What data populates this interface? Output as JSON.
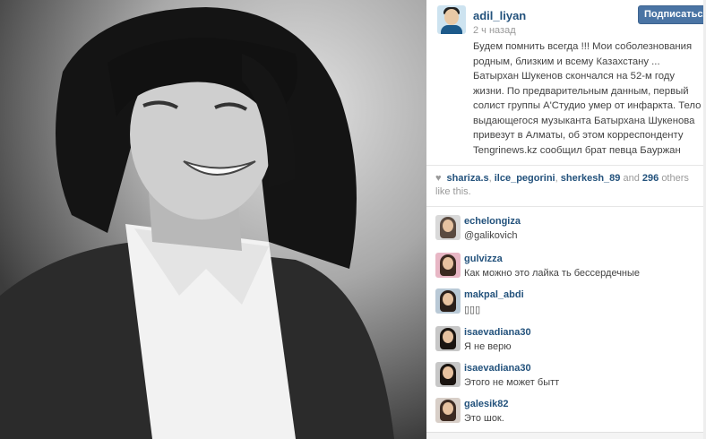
{
  "post": {
    "username": "adil_liyan",
    "time": "2 ч назад",
    "follow_label": "Подписаться",
    "caption": "Будем помнить всегда !!! Мои соболезнования родным, близким и всему Казахстану ... Батырхан Шукенов скончался на 52-м году жизни. По предварительным данным, первый солист группы А'Студио умер от инфаркта. Тело выдающегося музыканта Батырхана Шукенова привезут в Алматы, об этом корреспонденту Tengrinews.kz сообщил брат певца Бауржан"
  },
  "likes": {
    "icon": "heart-icon",
    "user1": "shariza.s",
    "user2": "ilce_pegorini",
    "user3": "sherkesh_89",
    "and": "and",
    "count": "296",
    "rest": "others like this."
  },
  "comments": [
    {
      "user": "echelongiza",
      "text": "@galikovich"
    },
    {
      "user": "gulvizza",
      "text": "Как можно это лайка ть бессердечные"
    },
    {
      "user": "makpal_abdi",
      "text": "▯▯▯"
    },
    {
      "user": "isaevadiana30",
      "text": "Я не верю"
    },
    {
      "user": "isaevadiana30",
      "text": "Этого не может бытт"
    },
    {
      "user": "galesik82",
      "text": "Это шок."
    }
  ],
  "colors": {
    "link": "#23527c",
    "follow_bg": "#4a74a4",
    "muted": "#999999"
  }
}
